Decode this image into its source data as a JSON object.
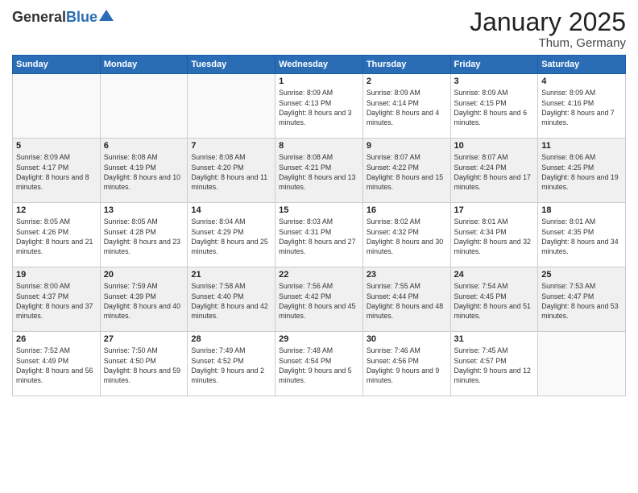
{
  "header": {
    "logo_general": "General",
    "logo_blue": "Blue",
    "title": "January 2025",
    "subtitle": "Thum, Germany"
  },
  "days_of_week": [
    "Sunday",
    "Monday",
    "Tuesday",
    "Wednesday",
    "Thursday",
    "Friday",
    "Saturday"
  ],
  "weeks": [
    [
      {
        "day": "",
        "info": ""
      },
      {
        "day": "",
        "info": ""
      },
      {
        "day": "",
        "info": ""
      },
      {
        "day": "1",
        "info": "Sunrise: 8:09 AM\nSunset: 4:13 PM\nDaylight: 8 hours and 3 minutes."
      },
      {
        "day": "2",
        "info": "Sunrise: 8:09 AM\nSunset: 4:14 PM\nDaylight: 8 hours and 4 minutes."
      },
      {
        "day": "3",
        "info": "Sunrise: 8:09 AM\nSunset: 4:15 PM\nDaylight: 8 hours and 6 minutes."
      },
      {
        "day": "4",
        "info": "Sunrise: 8:09 AM\nSunset: 4:16 PM\nDaylight: 8 hours and 7 minutes."
      }
    ],
    [
      {
        "day": "5",
        "info": "Sunrise: 8:09 AM\nSunset: 4:17 PM\nDaylight: 8 hours and 8 minutes."
      },
      {
        "day": "6",
        "info": "Sunrise: 8:08 AM\nSunset: 4:19 PM\nDaylight: 8 hours and 10 minutes."
      },
      {
        "day": "7",
        "info": "Sunrise: 8:08 AM\nSunset: 4:20 PM\nDaylight: 8 hours and 11 minutes."
      },
      {
        "day": "8",
        "info": "Sunrise: 8:08 AM\nSunset: 4:21 PM\nDaylight: 8 hours and 13 minutes."
      },
      {
        "day": "9",
        "info": "Sunrise: 8:07 AM\nSunset: 4:22 PM\nDaylight: 8 hours and 15 minutes."
      },
      {
        "day": "10",
        "info": "Sunrise: 8:07 AM\nSunset: 4:24 PM\nDaylight: 8 hours and 17 minutes."
      },
      {
        "day": "11",
        "info": "Sunrise: 8:06 AM\nSunset: 4:25 PM\nDaylight: 8 hours and 19 minutes."
      }
    ],
    [
      {
        "day": "12",
        "info": "Sunrise: 8:05 AM\nSunset: 4:26 PM\nDaylight: 8 hours and 21 minutes."
      },
      {
        "day": "13",
        "info": "Sunrise: 8:05 AM\nSunset: 4:28 PM\nDaylight: 8 hours and 23 minutes."
      },
      {
        "day": "14",
        "info": "Sunrise: 8:04 AM\nSunset: 4:29 PM\nDaylight: 8 hours and 25 minutes."
      },
      {
        "day": "15",
        "info": "Sunrise: 8:03 AM\nSunset: 4:31 PM\nDaylight: 8 hours and 27 minutes."
      },
      {
        "day": "16",
        "info": "Sunrise: 8:02 AM\nSunset: 4:32 PM\nDaylight: 8 hours and 30 minutes."
      },
      {
        "day": "17",
        "info": "Sunrise: 8:01 AM\nSunset: 4:34 PM\nDaylight: 8 hours and 32 minutes."
      },
      {
        "day": "18",
        "info": "Sunrise: 8:01 AM\nSunset: 4:35 PM\nDaylight: 8 hours and 34 minutes."
      }
    ],
    [
      {
        "day": "19",
        "info": "Sunrise: 8:00 AM\nSunset: 4:37 PM\nDaylight: 8 hours and 37 minutes."
      },
      {
        "day": "20",
        "info": "Sunrise: 7:59 AM\nSunset: 4:39 PM\nDaylight: 8 hours and 40 minutes."
      },
      {
        "day": "21",
        "info": "Sunrise: 7:58 AM\nSunset: 4:40 PM\nDaylight: 8 hours and 42 minutes."
      },
      {
        "day": "22",
        "info": "Sunrise: 7:56 AM\nSunset: 4:42 PM\nDaylight: 8 hours and 45 minutes."
      },
      {
        "day": "23",
        "info": "Sunrise: 7:55 AM\nSunset: 4:44 PM\nDaylight: 8 hours and 48 minutes."
      },
      {
        "day": "24",
        "info": "Sunrise: 7:54 AM\nSunset: 4:45 PM\nDaylight: 8 hours and 51 minutes."
      },
      {
        "day": "25",
        "info": "Sunrise: 7:53 AM\nSunset: 4:47 PM\nDaylight: 8 hours and 53 minutes."
      }
    ],
    [
      {
        "day": "26",
        "info": "Sunrise: 7:52 AM\nSunset: 4:49 PM\nDaylight: 8 hours and 56 minutes."
      },
      {
        "day": "27",
        "info": "Sunrise: 7:50 AM\nSunset: 4:50 PM\nDaylight: 8 hours and 59 minutes."
      },
      {
        "day": "28",
        "info": "Sunrise: 7:49 AM\nSunset: 4:52 PM\nDaylight: 9 hours and 2 minutes."
      },
      {
        "day": "29",
        "info": "Sunrise: 7:48 AM\nSunset: 4:54 PM\nDaylight: 9 hours and 5 minutes."
      },
      {
        "day": "30",
        "info": "Sunrise: 7:46 AM\nSunset: 4:56 PM\nDaylight: 9 hours and 9 minutes."
      },
      {
        "day": "31",
        "info": "Sunrise: 7:45 AM\nSunset: 4:57 PM\nDaylight: 9 hours and 12 minutes."
      },
      {
        "day": "",
        "info": ""
      }
    ]
  ]
}
